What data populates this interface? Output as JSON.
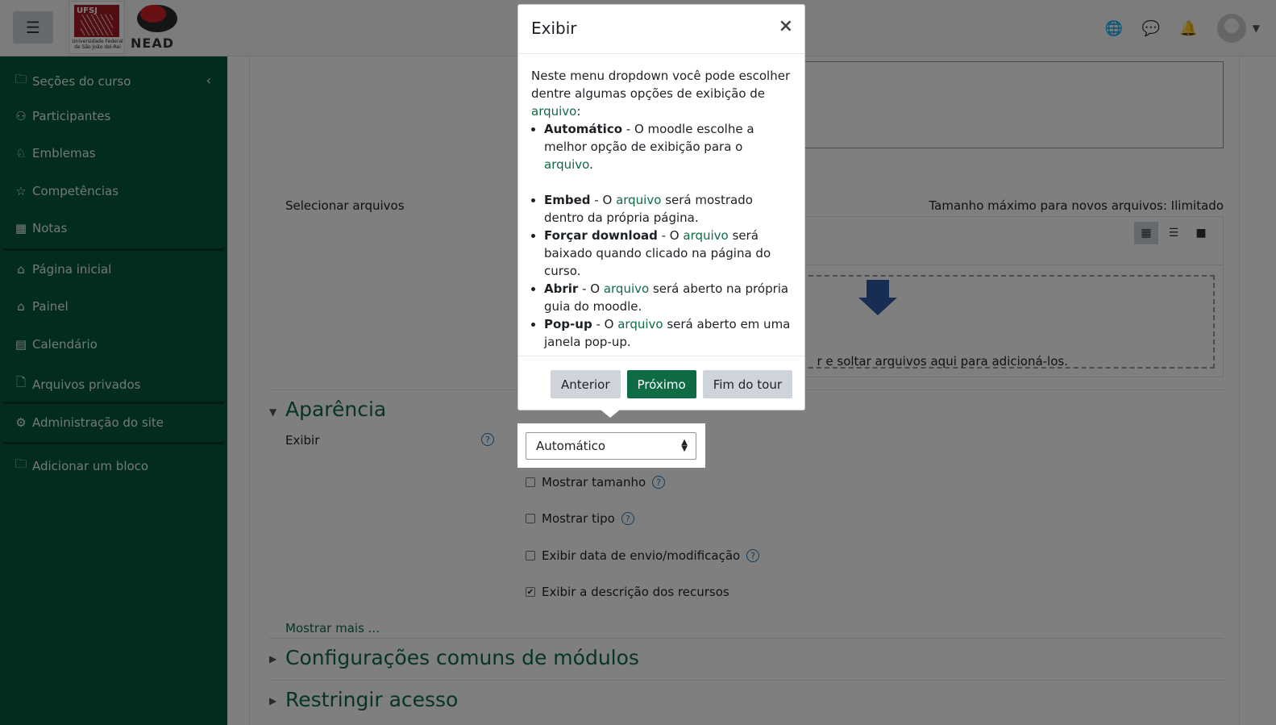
{
  "header": {
    "menu_icon": "hamburger-icon",
    "ufsj_logo_text": "UFSJ",
    "ufsj_caption": "Universidade Federal de São João del-Rei",
    "nead_text": "NEAD",
    "icons": [
      "globe-icon",
      "chat-icon",
      "bell-icon",
      "avatar",
      "chevron-down-icon"
    ]
  },
  "sidebar": {
    "items": [
      {
        "label": "Seções do curso",
        "icon": "folder-icon"
      },
      {
        "label": "Participantes",
        "icon": "users-icon"
      },
      {
        "label": "Emblemas",
        "icon": "badge-icon"
      },
      {
        "label": "Competências",
        "icon": "star-icon"
      },
      {
        "label": "Notas",
        "icon": "table-icon"
      },
      {
        "label": "Página inicial",
        "icon": "home-icon"
      },
      {
        "label": "Painel",
        "icon": "home-icon"
      },
      {
        "label": "Calendário",
        "icon": "calendar-icon"
      },
      {
        "label": "Arquivos privados",
        "icon": "file-icon"
      },
      {
        "label": "Administração do site",
        "icon": "gear-icon"
      },
      {
        "label": "Adicionar um bloco",
        "icon": "folder-icon"
      }
    ]
  },
  "main": {
    "select_files_label": "Selecionar arquivos",
    "max_size_text": "Tamanho máximo para novos arquivos: Ilimitado",
    "drop_text": "r e soltar arquivos aqui para adicioná-los.",
    "appearance_section": "Aparência",
    "display_label": "Exibir",
    "display_value": "Automático",
    "checkboxes": [
      {
        "label": "Mostrar tamanho",
        "checked": false
      },
      {
        "label": "Mostrar tipo",
        "checked": false
      },
      {
        "label": "Exibir data de envio/modificação",
        "checked": false
      },
      {
        "label": "Exibir a descrição dos recursos",
        "checked": true
      }
    ],
    "show_more": "Mostrar mais ...",
    "section_common": "Configurações comuns de módulos",
    "section_restrict": "Restringir acesso"
  },
  "popover": {
    "title": "Exibir",
    "close": "×",
    "intro_pre": "Neste menu dropdown você pode escolher dentre algumas opções de exibição de ",
    "intro_link": "arquivo",
    "intro_post": ":",
    "items": [
      {
        "term": "Automático",
        "pre": " - O moodle escolhe a melhor opção de exibição para o ",
        "link": "arquivo",
        "post": "."
      },
      {
        "term": "Embed",
        "pre": " - O ",
        "link": "arquivo",
        "post": " será mostrado dentro da própria página."
      },
      {
        "term": "Forçar download",
        "pre": " - O ",
        "link": "arquivo",
        "post": " será baixado quando clicado na página do curso."
      },
      {
        "term": "Abrir",
        "pre": " - O ",
        "link": "arquivo",
        "post": " será aberto na própria guia do moodle."
      },
      {
        "term": "Pop-up",
        "pre": " - O ",
        "link": "arquivo",
        "post": " será aberto em uma janela pop-up."
      }
    ],
    "btn_prev": "Anterior",
    "btn_next": "Próximo",
    "btn_end": "Fim do tour"
  },
  "colors": {
    "sidebar": "#04593a",
    "accent": "#0f6b44",
    "link": "#0f6b44"
  }
}
